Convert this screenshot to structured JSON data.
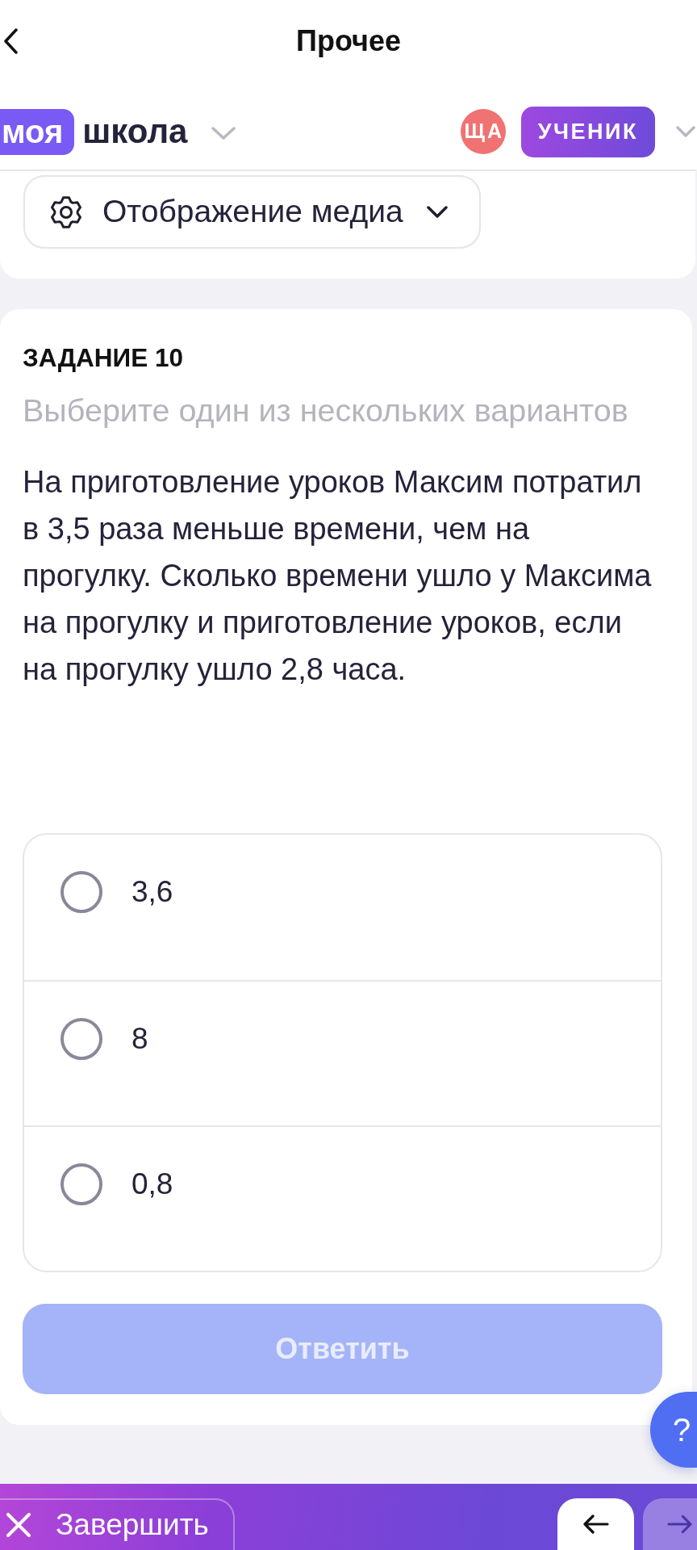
{
  "header": {
    "title": "Прочее"
  },
  "brand": {
    "badge": "моя",
    "name": "школа"
  },
  "user": {
    "initials": "ЩА",
    "role": "УЧЕНИК"
  },
  "media_menu": {
    "label": "Отображение медиа"
  },
  "task": {
    "title": "ЗАДАНИЕ 10",
    "hint": "Выберите один из нескольких вариантов",
    "question": "На приготовление уроков Максим потратил в 3,5 раза меньше времени, чем на прогулку. Сколько времени ушло у Максима на прогулку и приготовление уроков, если на прогулку ушло 2,8 часа.",
    "options": [
      {
        "label": "3,6",
        "selected": false
      },
      {
        "label": "8",
        "selected": false
      },
      {
        "label": "0,8",
        "selected": false
      }
    ],
    "submit": {
      "label": "Ответить",
      "disabled": true
    }
  },
  "help_button": {
    "label": "?"
  },
  "footer": {
    "finish_label": "Завершить",
    "prev": {
      "disabled": false
    },
    "next": {
      "disabled": true
    }
  }
}
